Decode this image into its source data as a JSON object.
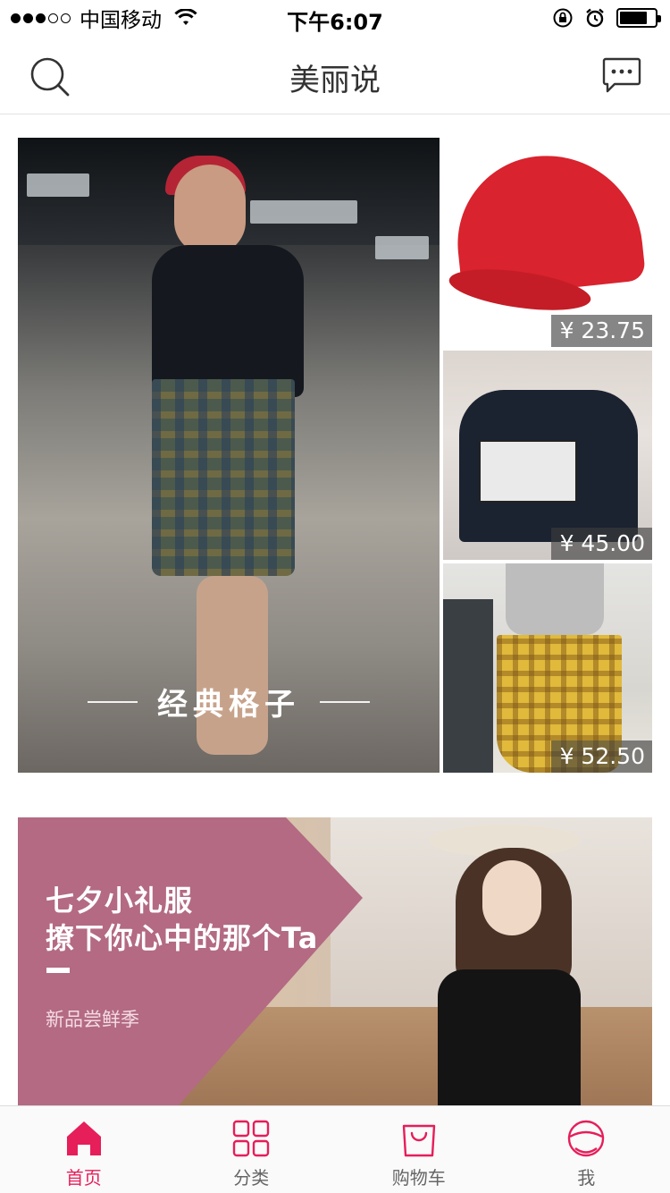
{
  "status_bar": {
    "carrier": "中国移动",
    "time": "下午6:07",
    "signal_dots": [
      "filled",
      "filled",
      "filled",
      "empty",
      "empty"
    ],
    "icons": [
      "wifi-icon",
      "rotation-lock-icon",
      "alarm-icon",
      "battery-icon"
    ]
  },
  "nav": {
    "title": "美丽说",
    "left_icon": "search-icon",
    "right_icon": "message-icon"
  },
  "feature": {
    "caption": "经典格子",
    "products": [
      {
        "name": "red baseball cap",
        "price": "¥ 23.75"
      },
      {
        "name": "black graphic tee",
        "price": "¥ 45.00"
      },
      {
        "name": "yellow plaid skirt",
        "price": "¥ 52.50"
      }
    ]
  },
  "banner": {
    "line1": "七夕小礼服",
    "line2": "撩下你心中的那个Ta",
    "subtitle": "新品尝鲜季",
    "panel_color": "#b36a82"
  },
  "tabbar": {
    "active_color": "#e61e5a",
    "items": [
      {
        "label": "首页",
        "icon": "home-icon",
        "active": true
      },
      {
        "label": "分类",
        "icon": "grid-icon",
        "active": false
      },
      {
        "label": "购物车",
        "icon": "shopping-bag-icon",
        "active": false
      },
      {
        "label": "我",
        "icon": "profile-icon",
        "active": false
      }
    ]
  }
}
